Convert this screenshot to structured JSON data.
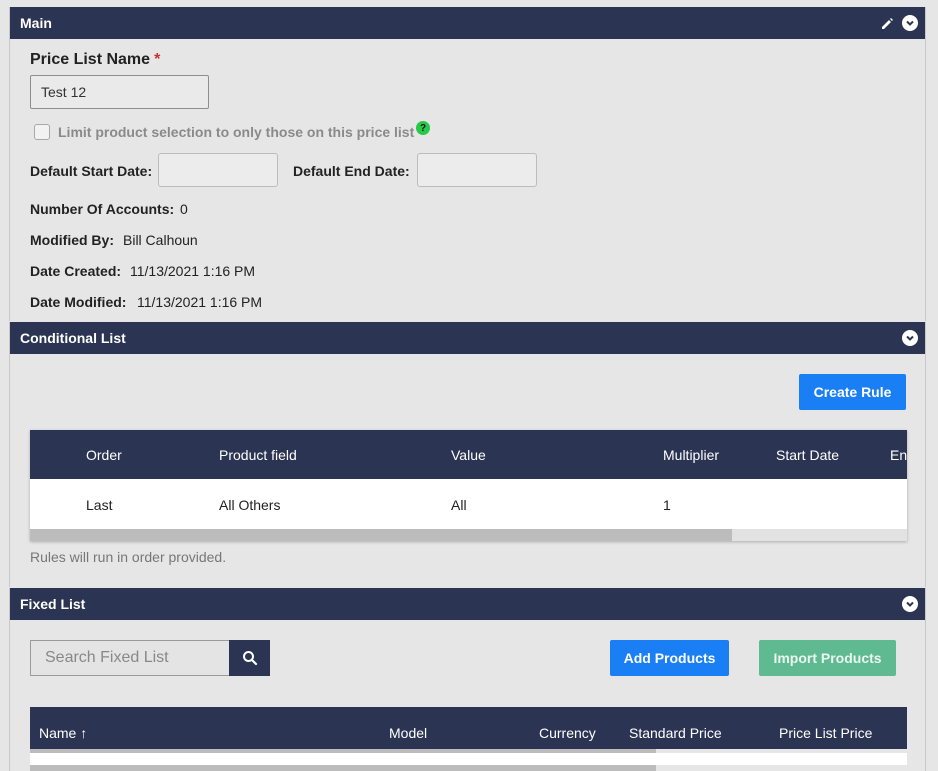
{
  "main": {
    "header": "Main",
    "name_label": "Price List Name",
    "required_mark": "*",
    "name_value": "Test 12",
    "limit_label": "Limit product selection to only those on this price list",
    "help_glyph": "?",
    "start_date_label": "Default Start Date:",
    "end_date_label": "Default End Date:",
    "accounts_label": "Number Of Accounts:",
    "accounts_value": "0",
    "modified_by_label": "Modified By:",
    "modified_by_value": "Bill Calhoun",
    "created_label": "Date Created:",
    "created_value": "11/13/2021 1:16 PM",
    "modified_label": "Date Modified:",
    "modified_value": "11/13/2021 1:16 PM",
    "icons": [
      "pencil-icon",
      "chevron-down-icon"
    ]
  },
  "conditional": {
    "header": "Conditional List",
    "create_rule": "Create Rule",
    "columns": [
      "Order",
      "Product field",
      "Value",
      "Multiplier",
      "Start Date",
      "En"
    ],
    "rows": [
      {
        "order": "Last",
        "field": "All Others",
        "value": "All",
        "multiplier": "1"
      }
    ],
    "scroll_position": 0.87,
    "note": "Rules will run in order provided."
  },
  "fixed": {
    "header": "Fixed List",
    "search_placeholder": "Search Fixed List",
    "add_products": "Add Products",
    "import_products": "Import Products",
    "columns": [
      "Name",
      "Model",
      "Currency",
      "Standard Price",
      "Price List Price"
    ],
    "sort_glyph": "↑"
  },
  "colors": {
    "header_bg": "#2b3452",
    "primary": "#1a7ff5",
    "success": "#5fba92",
    "help": "#28c84a",
    "required": "#d32f2f"
  }
}
